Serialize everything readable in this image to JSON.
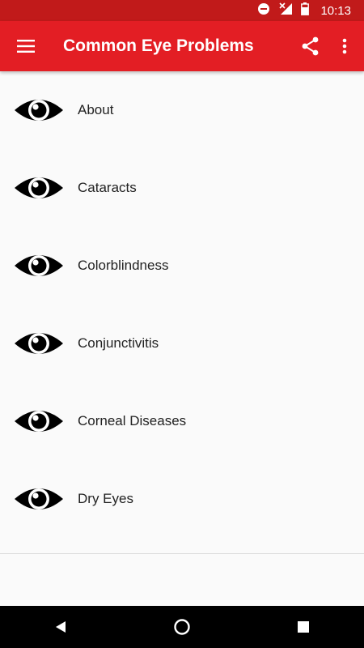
{
  "status_bar": {
    "time": "10:13",
    "icons": [
      "do-not-disturb-icon",
      "no-signal-icon",
      "battery-icon"
    ]
  },
  "app_bar": {
    "title": "Common Eye Problems",
    "icons": [
      "menu-icon",
      "share-icon",
      "more-vert-icon"
    ]
  },
  "list": {
    "items": [
      {
        "label": "About",
        "icon": "eye-icon"
      },
      {
        "label": "Cataracts",
        "icon": "eye-icon"
      },
      {
        "label": "Colorblindness",
        "icon": "eye-icon"
      },
      {
        "label": "Conjunctivitis",
        "icon": "eye-icon"
      },
      {
        "label": "Corneal Diseases",
        "icon": "eye-icon"
      },
      {
        "label": "Dry Eyes",
        "icon": "eye-icon"
      }
    ]
  },
  "nav_bar": {
    "icons": [
      "back-icon",
      "home-icon",
      "recents-icon"
    ]
  },
  "colors": {
    "app_bar": "#e31e24",
    "status_bar": "#c11a1a",
    "background": "#fafafa"
  }
}
